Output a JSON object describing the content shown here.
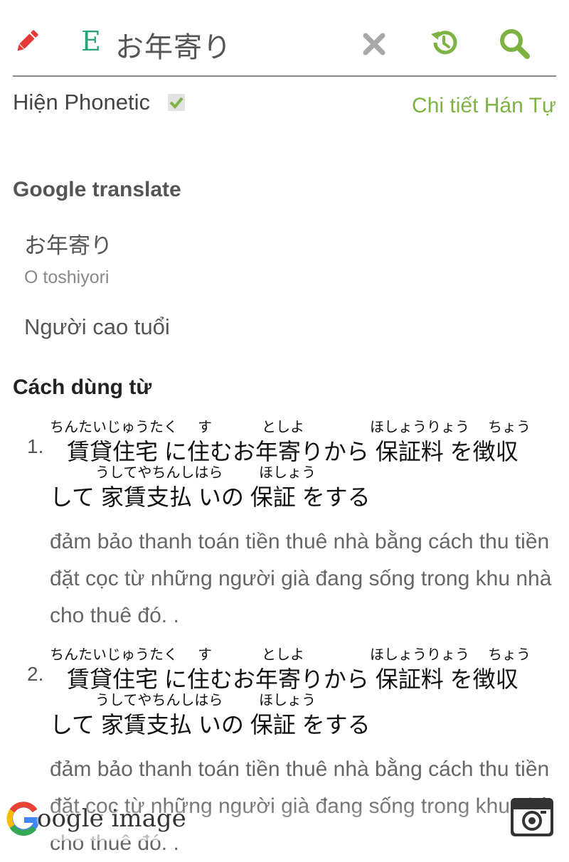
{
  "header": {
    "query": "お年寄り",
    "lang_icon": "E",
    "icons": [
      "pencil-icon",
      "lang-e-icon",
      "clear-icon",
      "history-icon",
      "search-icon"
    ],
    "colors": {
      "pencil": "#e53935",
      "lang": "#2aa37a",
      "clear": "#a8a8a8",
      "accent": "#7cb342"
    }
  },
  "options": {
    "phonetic_label": "Hiện Phonetic",
    "phonetic_checked": true,
    "detail_link": "Chi tiết Hán Tự"
  },
  "google_translate": {
    "title": "Google translate",
    "source": "お年寄り",
    "romaji": "O toshiyori",
    "translation": "Người cao tuổi"
  },
  "usage": {
    "title": "Cách dùng từ",
    "examples": [
      {
        "number": "1.",
        "line1": {
          "text": "賃貸住宅 に住むお年寄りから 保証料 を徴収",
          "furigana": [
            "ちんたいじゅうたく",
            "す",
            "としよ",
            "ほしょうりょう",
            "ちょう"
          ]
        },
        "line2": {
          "text": "して 家賃支払 いの 保証 をする",
          "furigana": [
            "うしてやちんしはら",
            "ほしょう"
          ]
        },
        "translation": "đảm bảo thanh toán tiền thuê nhà bằng cách thu tiền đặt cọc từ những người già đang sống trong khu nhà cho thuê đó. ."
      },
      {
        "number": "2.",
        "line1": {
          "text": "賃貸住宅 に住むお年寄りから 保証料 を徴収",
          "furigana": [
            "ちんたいじゅうたく",
            "す",
            "としよ",
            "ほしょうりょう",
            "ちょう"
          ]
        },
        "line2": {
          "text": "して 家賃支払 いの 保証 をする",
          "furigana": [
            "うしてやちんしはら",
            "ほしょう"
          ]
        },
        "translation": "đảm bảo thanh toán tiền thuê nhà bằng cách thu tiền đặt cọc từ những người già đang sống trong khu nhà cho thuê đó. ."
      }
    ]
  },
  "footer": {
    "google_image_label": "oogle image",
    "camera_icon": "camera-icon"
  }
}
